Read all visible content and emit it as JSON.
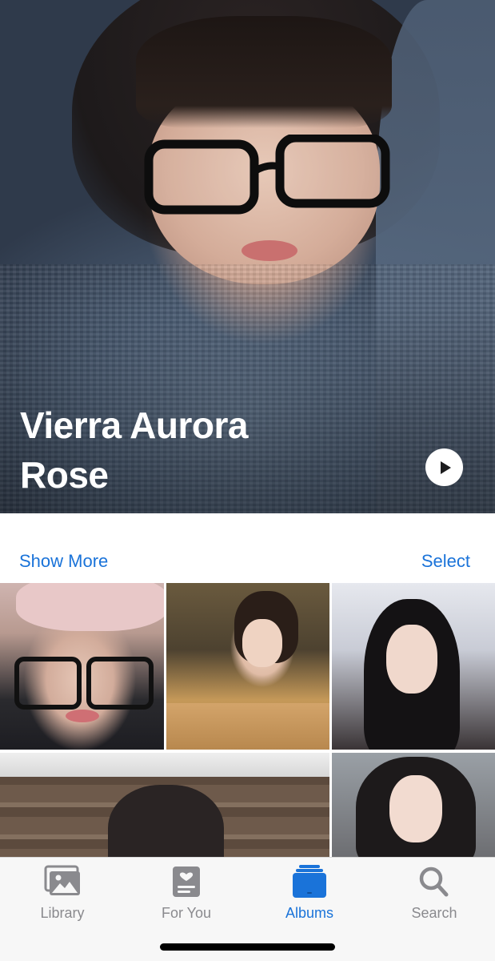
{
  "hero": {
    "title": "Vierra Aurora Rose",
    "play_icon": "play-icon"
  },
  "actions": {
    "show_more_label": "Show More",
    "select_label": "Select"
  },
  "grid": {
    "photo_count_visible": 5
  },
  "tab_bar": {
    "tabs": [
      {
        "label": "Library",
        "icon": "photo-library-icon",
        "active": false
      },
      {
        "label": "For You",
        "icon": "for-you-icon",
        "active": false
      },
      {
        "label": "Albums",
        "icon": "albums-icon",
        "active": true
      },
      {
        "label": "Search",
        "icon": "search-icon",
        "active": false
      }
    ]
  },
  "colors": {
    "accent": "#1a73d9",
    "inactive": "#8a8a8e",
    "tab_bar_bg": "#f7f7f7"
  }
}
